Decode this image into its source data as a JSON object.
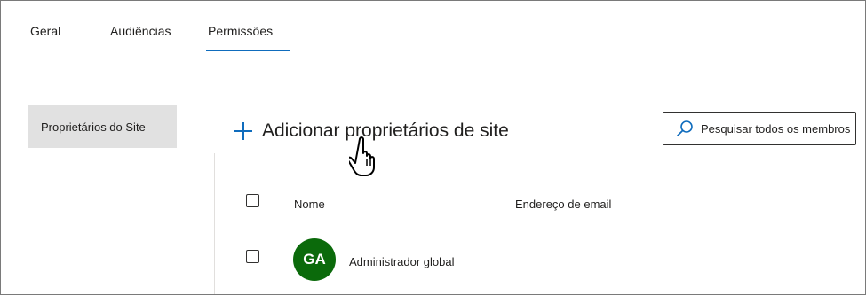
{
  "tabs": [
    {
      "label": "Geral"
    },
    {
      "label": "Audiências"
    },
    {
      "label": "Permissões",
      "selected": true
    }
  ],
  "sidebar": {
    "items": [
      {
        "label": "Proprietários do Site",
        "selected": true
      }
    ]
  },
  "toolbar": {
    "add_label": "Adicionar proprietários de site",
    "add_icon": "plus-icon"
  },
  "search": {
    "placeholder": "Pesquisar todos os membros",
    "icon": "search-icon"
  },
  "table": {
    "columns": [
      "Nome",
      "Endereço de email"
    ],
    "rows": [
      {
        "initials": "GA",
        "name": "Administrador global",
        "email": "",
        "avatar_color": "#0b6a0b"
      }
    ]
  },
  "colors": {
    "accent": "#0f6cbd",
    "selected_nav_bg": "#e1e1e1",
    "avatar": "#0b6a0b"
  }
}
